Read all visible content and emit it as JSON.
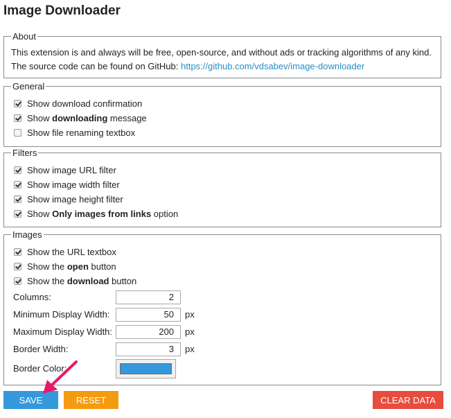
{
  "title": "Image Downloader",
  "about": {
    "legend": "About",
    "line1": "This extension is and always will be free, open-source, and without ads or tracking algorithms of any kind.",
    "line2_prefix": "The source code can be found on GitHub: ",
    "link": "https://github.com/vdsabev/image-downloader"
  },
  "general": {
    "legend": "General",
    "items": [
      {
        "parts": [
          "Show download confirmation"
        ],
        "checked": true
      },
      {
        "parts": [
          "Show ",
          "downloading",
          " message"
        ],
        "checked": true
      },
      {
        "parts": [
          "Show file renaming textbox"
        ],
        "checked": false
      }
    ]
  },
  "filters": {
    "legend": "Filters",
    "items": [
      {
        "parts": [
          "Show image URL filter"
        ],
        "checked": true
      },
      {
        "parts": [
          "Show image width filter"
        ],
        "checked": true
      },
      {
        "parts": [
          "Show image height filter"
        ],
        "checked": true
      },
      {
        "parts": [
          "Show ",
          "Only images from links",
          " option"
        ],
        "checked": true
      }
    ]
  },
  "images": {
    "legend": "Images",
    "items": [
      {
        "parts": [
          "Show the URL textbox"
        ],
        "checked": true
      },
      {
        "parts": [
          "Show the ",
          "open",
          " button"
        ],
        "checked": true
      },
      {
        "parts": [
          "Show the ",
          "download",
          " button"
        ],
        "checked": true
      }
    ],
    "columns": {
      "label": "Columns:",
      "value": "2"
    },
    "min_width": {
      "label": "Minimum Display Width:",
      "value": "50",
      "unit": "px"
    },
    "max_width": {
      "label": "Maximum Display Width:",
      "value": "200",
      "unit": "px"
    },
    "border_width": {
      "label": "Border Width:",
      "value": "3",
      "unit": "px"
    },
    "border_color": {
      "label": "Border Color:",
      "value": "#3498db"
    }
  },
  "buttons": {
    "save": "SAVE",
    "reset": "RESET",
    "clear": "CLEAR DATA"
  },
  "colors": {
    "save": "#3498db",
    "reset": "#f39c12",
    "clear": "#e74c3c",
    "link": "#2a8ec4",
    "arrow": "#e8196b"
  }
}
